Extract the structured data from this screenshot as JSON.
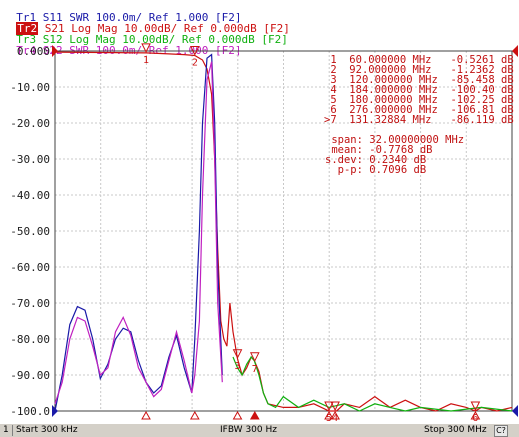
{
  "traces": [
    {
      "id": "Tr1",
      "param": "S11",
      "format": "SWR",
      "scale": "100.0m/",
      "ref": "Ref 1.000",
      "channel": "[F2]",
      "color": "#1a1aa8",
      "active": false
    },
    {
      "id": "Tr2",
      "param": "S21",
      "format": "Log Mag",
      "scale": "10.00dB/",
      "ref": "Ref 0.000dB",
      "channel": "[F2]",
      "color": "#cc1010",
      "active": true
    },
    {
      "id": "Tr3",
      "param": "S12",
      "format": "Log Mag",
      "scale": "10.00dB/",
      "ref": "Ref 0.000dB",
      "channel": "[F2]",
      "color": "#10b010",
      "active": false
    },
    {
      "id": "Tr4",
      "param": "S22",
      "format": "SWR",
      "scale": "100.0m/",
      "ref": "Ref 1.000",
      "channel": "[F2]",
      "color": "#c020c0",
      "active": false
    }
  ],
  "y_axis": {
    "labels": [
      "0.000",
      "-10.00",
      "-20.00",
      "-30.00",
      "-40.00",
      "-50.00",
      "-60.00",
      "-70.00",
      "-80.00",
      "-90.00",
      "-100.0"
    ]
  },
  "markers": [
    {
      "num": "1",
      "freq": "60.000000 MHz",
      "value": "-0.5261 dB"
    },
    {
      "num": "2",
      "freq": "92.000000 MHz",
      "value": "-1.2362 dB"
    },
    {
      "num": "3",
      "freq": "120.000000 MHz",
      "value": "-85.458 dB"
    },
    {
      "num": "4",
      "freq": "184.000000 MHz",
      "value": "-100.40 dB"
    },
    {
      "num": "5",
      "freq": "180.000000 MHz",
      "value": "-102.25 dB"
    },
    {
      "num": "6",
      "freq": "276.000000 MHz",
      "value": "-106.81 dB"
    },
    {
      "num": ">7",
      "freq": "131.32884 MHz",
      "value": "-86.119 dB"
    }
  ],
  "stats": [
    {
      "label": "span:",
      "value": "32.00000000 MHz"
    },
    {
      "label": "mean:",
      "value": "-0.7768 dB"
    },
    {
      "label": "s.dev:",
      "value": "0.2340 dB"
    },
    {
      "label": "p-p:",
      "value": "0.7096 dB"
    }
  ],
  "statusbar": {
    "channel": "1",
    "start": "Start 300 kHz",
    "ifbw": "IFBW 300 Hz",
    "stop": "Stop 300 MHz",
    "indicator": "C?"
  },
  "chart_data": {
    "type": "line",
    "xlabel": "",
    "ylabel": "",
    "x_range_mhz": [
      0.3,
      300
    ],
    "ylim": [
      -100,
      0
    ],
    "grid": true,
    "series": [
      {
        "name": "S21",
        "color": "#cc1010",
        "x": [
          0.3,
          20,
          40,
          60,
          75,
          85,
          92,
          97,
          100,
          103,
          105,
          107,
          109,
          111,
          113,
          115,
          117,
          120,
          123,
          126,
          129,
          131,
          134,
          137,
          140,
          150,
          160,
          170,
          180,
          185,
          190,
          200,
          210,
          220,
          230,
          240,
          250,
          260,
          270,
          276,
          280,
          290,
          300
        ],
        "y": [
          -0.3,
          -0.4,
          -0.45,
          -0.53,
          -0.8,
          -1.0,
          -1.24,
          -2.5,
          -5,
          -12,
          -30,
          -55,
          -75,
          -80,
          -82,
          -70,
          -78,
          -85.5,
          -90,
          -88,
          -85,
          -86,
          -89,
          -95,
          -98,
          -99,
          -99,
          -98,
          -100.2,
          -100.4,
          -98,
          -99,
          -96,
          -99,
          -97,
          -99,
          -100,
          -98,
          -99,
          -106.8,
          -99,
          -100,
          -99
        ]
      },
      {
        "name": "S12",
        "color": "#10b010",
        "x": [
          117,
          120,
          123,
          126,
          129,
          131,
          134,
          137,
          140,
          145,
          150,
          160,
          170,
          180,
          190,
          200,
          210,
          220,
          230,
          240,
          260,
          280,
          300
        ],
        "y": [
          -85,
          -88,
          -90,
          -87,
          -85,
          -86,
          -90,
          -95,
          -98,
          -99,
          -96,
          -99,
          -97,
          -99,
          -98,
          -100,
          -98,
          -99,
          -100,
          -99,
          -100,
          -99,
          -100
        ]
      },
      {
        "name": "S11",
        "color": "#1a1aa8",
        "x": [
          0.3,
          5,
          10,
          15,
          20,
          25,
          30,
          35,
          40,
          45,
          50,
          55,
          60,
          65,
          70,
          75,
          80,
          85,
          90,
          92,
          95,
          97,
          100,
          103,
          105,
          107,
          110
        ],
        "y": [
          -100,
          -90,
          -76,
          -71,
          -72,
          -80,
          -91,
          -87,
          -80,
          -77,
          -78,
          -86,
          -92,
          -95,
          -93,
          -85,
          -79,
          -88,
          -95,
          -80,
          -50,
          -20,
          -2,
          -1,
          -20,
          -60,
          -90
        ]
      },
      {
        "name": "S22",
        "color": "#c020c0",
        "x": [
          0.3,
          5,
          10,
          15,
          20,
          25,
          30,
          35,
          40,
          45,
          50,
          55,
          60,
          65,
          70,
          75,
          80,
          85,
          90,
          92,
          95,
          97,
          100,
          103,
          105,
          107,
          110
        ],
        "y": [
          -98,
          -92,
          -80,
          -74,
          -75,
          -82,
          -90,
          -88,
          -78,
          -74,
          -79,
          -88,
          -92,
          -96,
          -94,
          -86,
          -78,
          -86,
          -95,
          -90,
          -75,
          -40,
          -8,
          -3,
          -30,
          -70,
          -92
        ]
      }
    ]
  }
}
